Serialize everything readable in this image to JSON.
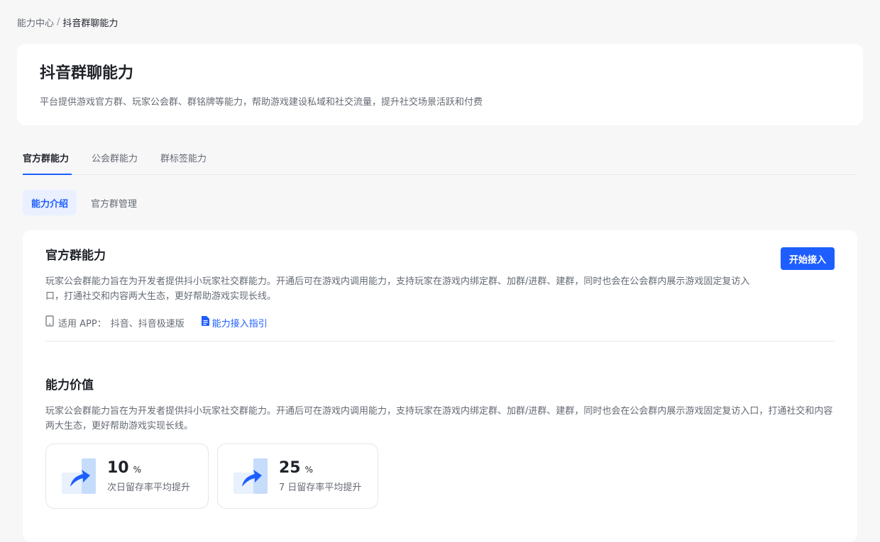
{
  "breadcrumb": {
    "parent": "能力中心",
    "separator": "/",
    "current": "抖音群聊能力"
  },
  "hero": {
    "title": "抖音群聊能力",
    "description": "平台提供游戏官方群、玩家公会群、群铭牌等能力，帮助游戏建设私域和社交流量，提升社交场景活跃和付费"
  },
  "tabs": [
    {
      "label": "官方群能力",
      "active": true
    },
    {
      "label": "公会群能力",
      "active": false
    },
    {
      "label": "群标签能力",
      "active": false
    }
  ],
  "subtabs": [
    {
      "label": "能力介绍",
      "active": true
    },
    {
      "label": "官方群管理",
      "active": false
    }
  ],
  "intro": {
    "title": "官方群能力",
    "start_button": "开始接入",
    "description": "玩家公会群能力旨在为开发者提供抖小玩家社交群能力。开通后可在游戏内调用能力，支持玩家在游戏内绑定群、加群/进群、建群，同时也会在公会群内展示游戏固定复访入口，打通社交和内容两大生态，更好帮助游戏实现长线。",
    "app_label": "适用 APP：",
    "app_value": "抖音、抖音极速版",
    "guide_link": "能力接入指引"
  },
  "value": {
    "title": "能力价值",
    "description": "玩家公会群能力旨在为开发者提供抖小玩家社交群能力。开通后可在游戏内调用能力，支持玩家在游戏内绑定群、加群/进群、建群，同时也会在公会群内展示游戏固定复访入口，打通社交和内容两大生态，更好帮助游戏实现长线。",
    "stats": [
      {
        "value": "10",
        "unit": "%",
        "label": "次日留存率平均提升"
      },
      {
        "value": "25",
        "unit": "%",
        "label": "7 日留存率平均提升"
      }
    ]
  },
  "colors": {
    "accent": "#1e5eff",
    "background": "#f7f7f8"
  },
  "icons": [
    "phone-icon",
    "document-icon",
    "trend-up-icon"
  ]
}
